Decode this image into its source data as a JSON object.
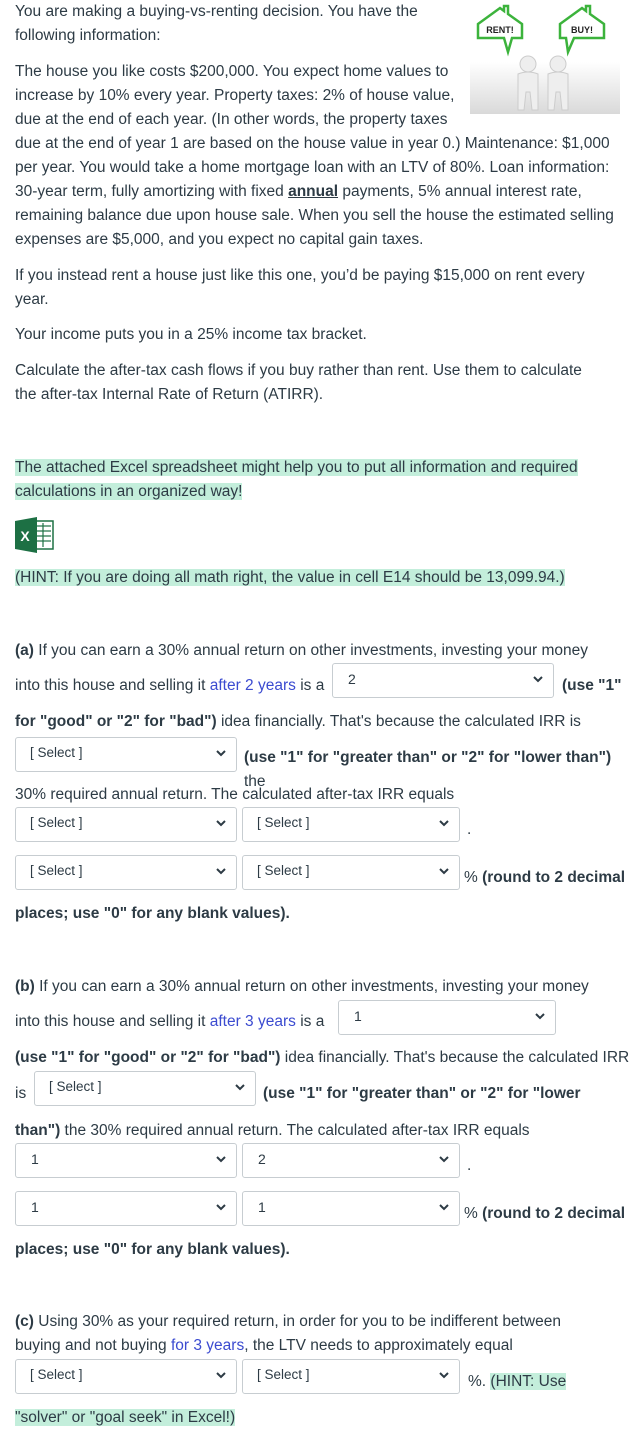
{
  "intro": {
    "line1": "You are making a buying-vs-renting decision. You have the",
    "line2": "following information:",
    "house_l1": "The house you like costs $200,000. You expect home values to",
    "house_l2": "increase by 10% every year. Property taxes: 2% of house value,",
    "house_l3": "due at the end of each year. (In other words, the property taxes",
    "house_l4": "due at the end of year 1 are based on the house value in year 0.) Maintenance: $1,000",
    "house_l5": "per year. You would take a home mortgage loan with an LTV of 80%. Loan information:",
    "house_l6a": "30-year term, fully amortizing with fixed ",
    "house_l6b": "annual",
    "house_l6c": " payments, 5% annual interest rate,",
    "house_l7": "remaining balance due upon house sale. When you sell the house the estimated selling",
    "house_l8": "expenses are $5,000, and you expect no capital gain taxes.",
    "rent_l1": "If you instead rent a house just like this one, you’d be paying $15,000 on rent every",
    "rent_l2": "year.",
    "tax": "Your income puts you in a 25% income tax bracket.",
    "calc_l1": "Calculate the after-tax cash flows if you buy rather than rent. Use them to calculate",
    "calc_l2": "the after-tax Internal Rate of Return (ATIRR).",
    "image_labels": {
      "left": "RENT!",
      "right": "BUY!"
    }
  },
  "excel": {
    "note_l1": "The attached Excel spreadsheet might help you to put all information and required",
    "note_l2": "calculations in an organized way!",
    "icon": "excel-file-icon",
    "hint": "(HINT: If you are doing all math right, the value in cell E14 should be 13,099.94.)"
  },
  "qa": {
    "label": "(a)",
    "l1": " If you can earn a 30% annual return on other investments, investing your money",
    "l2a": "into this house and selling it ",
    "l2b": "after 2 years",
    "l2c": " is a",
    "l2d": "(use \"1\"",
    "l3a": "for \"good\" or \"2\" for \"bad\")",
    "l3b": " idea financially. That's because the calculated IRR is",
    "l4": "(use \"1\" for \"greater than\" or \"2\" for \"lower than\")",
    "l4b": " the",
    "l5": "30% required annual return. The calculated after-tax IRR equals",
    "dot": ".",
    "pct": "%",
    "round": " (round to 2 decimal",
    "l8": "places; use \"0\" for any blank values).",
    "selects": [
      "2",
      "[ Select ]",
      "[ Select ]",
      "[ Select ]",
      "[ Select ]",
      "[ Select ]"
    ]
  },
  "qb": {
    "label": "(b)",
    "l1": " If you can earn a 30% annual return on other investments, investing your money",
    "l2a": "into this house and selling it ",
    "l2b": "after 3 years",
    "l2c": " is a",
    "l3a": " (use \"1\" for \"good\" or \"2\" for \"bad\")",
    "l3b": " idea financially. That's because the calculated IRR",
    "l4a": "is",
    "l4b": "(use \"1\" for \"greater than\" or \"2\" for \"lower",
    "l5a": "than\")",
    "l5b": " the 30% required annual return. The calculated after-tax IRR equals",
    "dot": ".",
    "pct": "%",
    "round": " (round to 2 decimal",
    "l8": "places; use \"0\" for any blank values).",
    "selects": [
      "1",
      "[ Select ]",
      "1",
      "2",
      "1",
      "1"
    ]
  },
  "qc": {
    "label": "(c)",
    "l1": " Using 30% as your required return, in order for you to be indifferent between",
    "l2a": "buying and not buying ",
    "l2b": "for 3 years",
    "l2c": ", the LTV needs to approximately equal",
    "pct": "%.",
    "hint_a": "(HINT: Use",
    "hint_b": "\"solver\" or \"goal seek\" in Excel!)",
    "selects": [
      "[ Select ]",
      "[ Select ]"
    ]
  }
}
